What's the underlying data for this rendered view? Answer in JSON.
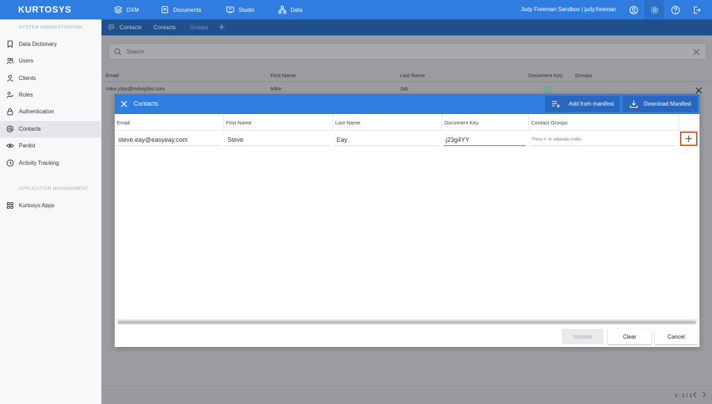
{
  "app": {
    "logo": "KURTOSYS",
    "user_label": "Judy Freeman Sandbox | judy.freeman"
  },
  "topnav": [
    {
      "label": "DXM",
      "icon": "layers-icon"
    },
    {
      "label": "Documents",
      "icon": "documents-icon"
    },
    {
      "label": "Studio",
      "icon": "studio-icon"
    },
    {
      "label": "Data",
      "icon": "hierarchy-icon"
    }
  ],
  "sidebar": {
    "section_system": "SYSTEM ADMINISTRATION",
    "section_apps": "APPLICATION MANAGEMENT",
    "items": [
      {
        "label": "Data Dictionary",
        "icon": "bookmark-icon"
      },
      {
        "label": "Users",
        "icon": "users-icon"
      },
      {
        "label": "Clients",
        "icon": "person-icon"
      },
      {
        "label": "Roles",
        "icon": "role-icon"
      },
      {
        "label": "Authentication",
        "icon": "lock-icon"
      },
      {
        "label": "Contacts",
        "icon": "at-icon",
        "active": true
      },
      {
        "label": "Pardot",
        "icon": "eye-icon"
      },
      {
        "label": "Activity Tracking",
        "icon": "clock-icon"
      }
    ],
    "apps_items": [
      {
        "label": "Kurtosys Apps",
        "icon": "grid-icon"
      }
    ]
  },
  "subnav": {
    "contacts": "Contacts",
    "contacts2": "Contacts",
    "groups": "Groups"
  },
  "search": {
    "placeholder": "Search"
  },
  "bg_table": {
    "headers": [
      "Email",
      "First Name",
      "Last Name",
      "Document Key",
      "Groups"
    ],
    "row": [
      "mike.jobs@mikejobs.com",
      "Mike",
      "Job"
    ]
  },
  "pager": {
    "text": "1 - 1 / 1"
  },
  "modal": {
    "title": "Contacts",
    "add_manifest": "Add from manifest",
    "download_manifest": "Download Manifest",
    "columns": [
      "Email",
      "First Name",
      "Last Name",
      "Document Key",
      "Contact Groups"
    ],
    "row": {
      "email": "steve.eay@easyeay.com",
      "first_name": "Steve",
      "last_name": "Eay",
      "document_key": "j23g4YY",
      "codes_placeholder": "Press ↵ to separate codes"
    },
    "validate": "Validate",
    "clear": "Clear",
    "cancel": "Cancel"
  },
  "colors": {
    "primary": "#2f7de1",
    "subbar": "#1f4f8d",
    "highlight": "#e4562d",
    "success": "#2eb67d"
  }
}
